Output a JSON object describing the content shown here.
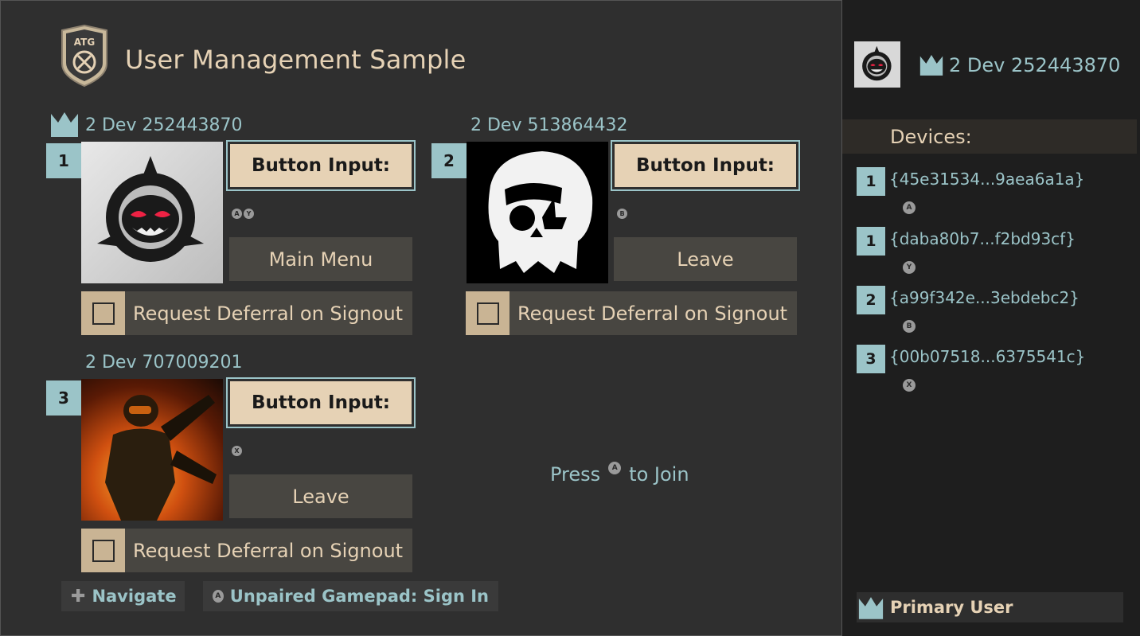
{
  "app": {
    "title": "User Management Sample",
    "logo_text": "ATG"
  },
  "users": [
    {
      "slot": "1",
      "gamertag": "2 Dev 252443870",
      "is_primary": true,
      "button_input_label": "Button Input:",
      "input_glyphs": [
        "A",
        "Y"
      ],
      "action_label": "Main Menu",
      "defer_label": "Request Deferral on Signout",
      "avatar": "shark-logo-avatar"
    },
    {
      "slot": "2",
      "gamertag": "2 Dev 513864432",
      "is_primary": false,
      "button_input_label": "Button Input:",
      "input_glyphs": [
        "B"
      ],
      "action_label": "Leave",
      "defer_label": "Request Deferral on Signout",
      "avatar": "skull-ship-avatar"
    },
    {
      "slot": "3",
      "gamertag": "2 Dev 707009201",
      "is_primary": false,
      "button_input_label": "Button Input:",
      "input_glyphs": [
        "X"
      ],
      "action_label": "Leave",
      "defer_label": "Request Deferral on Signout",
      "avatar": "soldier-avatar"
    }
  ],
  "join_prompt": {
    "before": "Press",
    "glyph": "A",
    "after": "to Join"
  },
  "footer": {
    "navigate_label": "Navigate",
    "navigate_icon": "dpad-icon",
    "signin_glyph": "A",
    "signin_label": "Unpaired Gamepad: Sign In"
  },
  "sidebar": {
    "current_user": "2 Dev 252443870",
    "devices_header": "Devices:",
    "devices": [
      {
        "slot": "1",
        "id": "{45e31534...9aea6a1a}",
        "glyph": "A"
      },
      {
        "slot": "1",
        "id": "{daba80b7...f2bd93cf}",
        "glyph": "Y"
      },
      {
        "slot": "2",
        "id": "{a99f342e...3ebdebc2}",
        "glyph": "B"
      },
      {
        "slot": "3",
        "id": "{00b07518...6375541c}",
        "glyph": "X"
      }
    ],
    "legend_label": "Primary User"
  },
  "colors": {
    "accent": "#9bc4c8",
    "tan": "#e6d2b5",
    "button_bg": "#484641",
    "panel_bg": "#2f2f2f",
    "sidebar_bg": "#1e1e1e"
  }
}
